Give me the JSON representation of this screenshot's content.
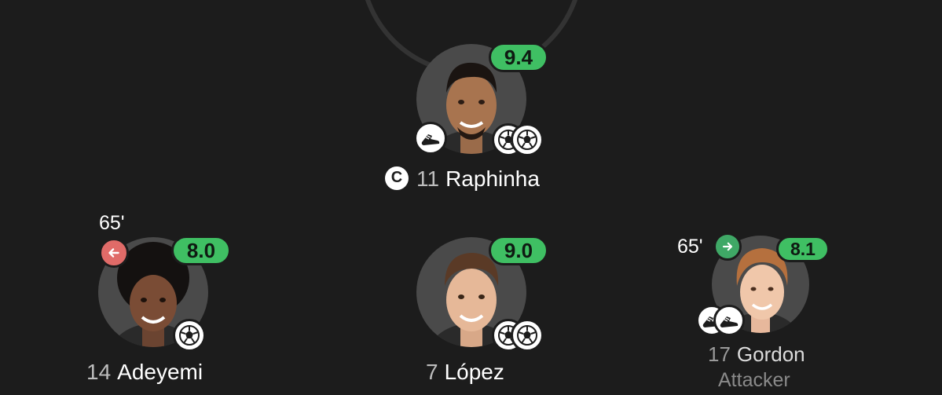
{
  "colors": {
    "background": "#1c1c1c",
    "rating_green": "#3fbf63",
    "sub_out": "#e06b68",
    "sub_in": "#3fa866"
  },
  "players": {
    "raphinha": {
      "rating": "9.4",
      "captain_mark": "C",
      "number": "11",
      "name": "Raphinha",
      "events": [
        "assist-boot-icon",
        "goal-ball-icon",
        "goal-ball-icon"
      ]
    },
    "adeyemi": {
      "rating": "8.0",
      "minute": "65'",
      "sub": "substituted-off-icon",
      "number": "14",
      "name": "Adeyemi",
      "events": [
        "goal-ball-icon"
      ]
    },
    "lopez": {
      "rating": "9.0",
      "number": "7",
      "name": "López",
      "events": [
        "goal-ball-icon",
        "goal-ball-icon"
      ]
    },
    "gordon": {
      "rating": "8.1",
      "minute": "65'",
      "sub": "substituted-on-icon",
      "number": "17",
      "name": "Gordon",
      "position": "Attacker",
      "events": [
        "assist-boot-icon",
        "assist-boot-icon"
      ]
    }
  }
}
